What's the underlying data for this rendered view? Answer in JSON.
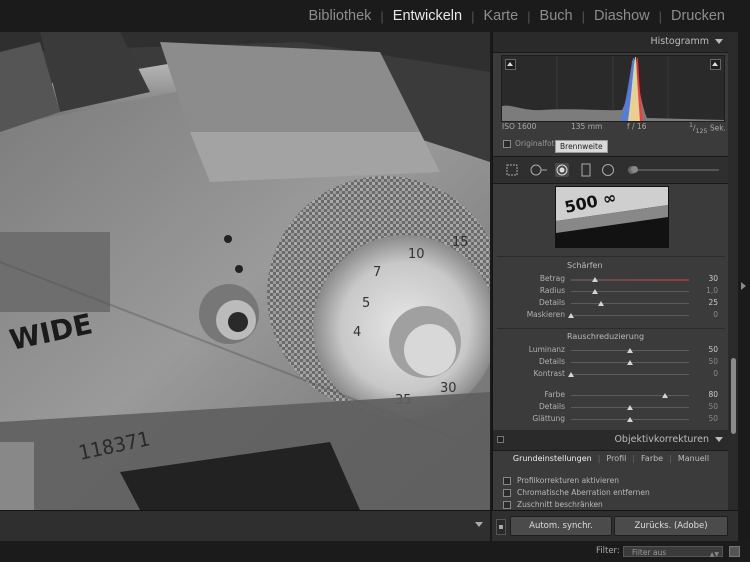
{
  "modules": [
    "Bibliothek",
    "Entwickeln",
    "Karte",
    "Buch",
    "Diashow",
    "Drucken"
  ],
  "module_sep": "|",
  "histogram": {
    "title": "Histogramm",
    "exif": {
      "iso": "ISO 1600",
      "focal": "135 mm",
      "aperture": "f / 16",
      "shutter_num": "1",
      "shutter_den": "125",
      "shutter_unit": "Sek."
    },
    "original_label": "Originalfoto",
    "tooltip": "Brennweite"
  },
  "photo": {
    "label_wide": "WIDE",
    "serial": "118371",
    "preview_text": "500 ∞"
  },
  "detail": {
    "sharpen": {
      "title": "Schärfen",
      "sliders": [
        {
          "label": "Betrag",
          "value": "30",
          "pos": 0.2,
          "colored": true
        },
        {
          "label": "Radius",
          "value": "1,0",
          "pos": 0.2,
          "dim": true
        },
        {
          "label": "Details",
          "value": "25",
          "pos": 0.25
        },
        {
          "label": "Maskieren",
          "value": "0",
          "pos": 0.0,
          "dim": true
        }
      ]
    },
    "noise": {
      "title": "Rauschreduzierung",
      "sliders": [
        {
          "label": "Luminanz",
          "value": "50",
          "pos": 0.5
        },
        {
          "label": "Details",
          "value": "50",
          "pos": 0.5,
          "dim": true
        },
        {
          "label": "Kontrast",
          "value": "0",
          "pos": 0.0,
          "dim": true
        },
        {
          "label": "Farbe",
          "value": "80",
          "pos": 0.8
        },
        {
          "label": "Details",
          "value": "50",
          "pos": 0.5,
          "dim": true
        },
        {
          "label": "Glättung",
          "value": "50",
          "pos": 0.5,
          "dim": true
        }
      ]
    }
  },
  "lens": {
    "title": "Objektivkorrekturen",
    "tabs": [
      "Grundeinstellungen",
      "Profil",
      "Farbe",
      "Manuell"
    ],
    "active_tab": 0,
    "checks": [
      "Profilkorrekturen aktivieren",
      "Chromatische Aberration entfernen",
      "Zuschnitt beschränken"
    ]
  },
  "sync": {
    "sync_label": "Autom. synchr.",
    "reset_label": "Zurücks. (Adobe)"
  },
  "filter": {
    "label": "Filter:",
    "value": "Filter aus"
  },
  "colors": {
    "bg": "#1a1a1a",
    "panel": "#3b3b3b",
    "header": "#2a2a2a",
    "text_active": "#e8e8e8",
    "text_inactive": "#8d8d8d"
  }
}
